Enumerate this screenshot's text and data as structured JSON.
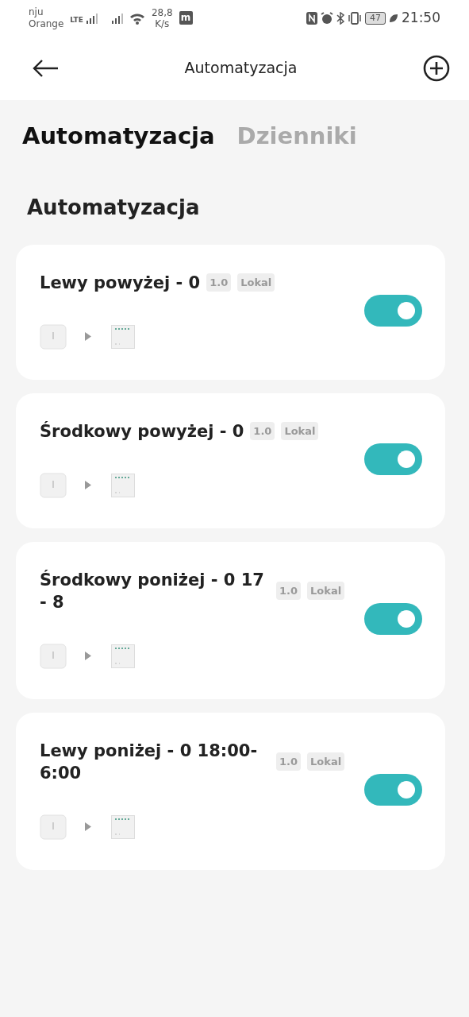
{
  "status_bar": {
    "carrier_top": "nju",
    "carrier": "Orange",
    "network": "LTE",
    "speed_value": "28,8",
    "speed_unit": "K/s",
    "app_letter": "m",
    "battery": "47",
    "time": "21:50"
  },
  "header": {
    "title": "Automatyzacja"
  },
  "tabs": [
    {
      "label": "Automatyzacja",
      "selected": true
    },
    {
      "label": "Dzienniki",
      "selected": false
    }
  ],
  "section_title": "Automatyzacja",
  "automations": [
    {
      "title": "Lewy powyżej - 0",
      "version": "1.0",
      "badge": "Lokal",
      "on": true
    },
    {
      "title": "Środkowy powyżej - 0",
      "version": "1.0",
      "badge": "Lokal",
      "on": true
    },
    {
      "title": "Środkowy poniżej - 0 17 - 8",
      "version": "1.0",
      "badge": "Lokal",
      "on": true
    },
    {
      "title": "Lewy poniżej - 0 18:00-6:00",
      "version": "1.0",
      "badge": "Lokal",
      "on": true
    }
  ]
}
